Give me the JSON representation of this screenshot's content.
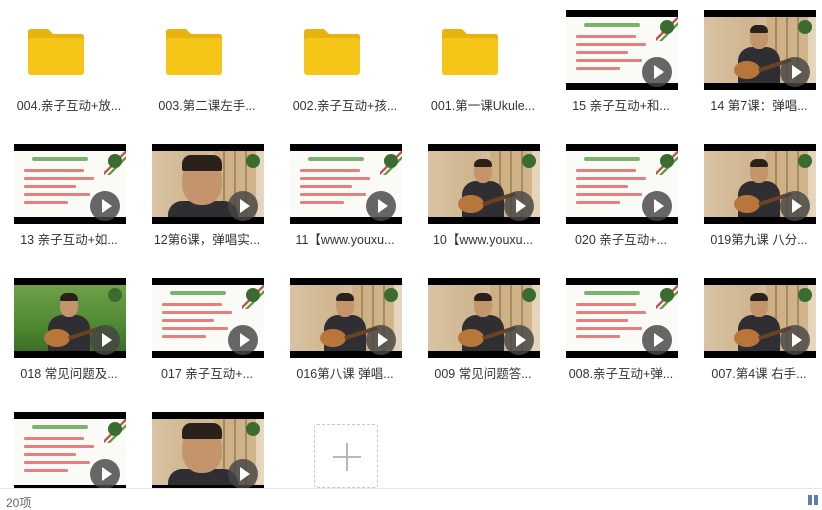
{
  "items": [
    {
      "type": "folder",
      "label": "004.亲子互动+放..."
    },
    {
      "type": "folder",
      "label": "003.第二课左手..."
    },
    {
      "type": "folder",
      "label": "002.亲子互动+孩..."
    },
    {
      "type": "folder",
      "label": "001.第一课Ukule..."
    },
    {
      "type": "video",
      "thumb": "slide",
      "label": "15  亲子互动+和..."
    },
    {
      "type": "video",
      "thumb": "person",
      "label": "14  第7课：弹唱..."
    },
    {
      "type": "video",
      "thumb": "slide",
      "label": "13  亲子互动+如..."
    },
    {
      "type": "video",
      "thumb": "close",
      "label": "12第6课，弹唱实..."
    },
    {
      "type": "video",
      "thumb": "slide",
      "label": "11【www.youxu..."
    },
    {
      "type": "video",
      "thumb": "person",
      "label": "10【www.youxu..."
    },
    {
      "type": "video",
      "thumb": "slide",
      "label": "020 亲子互动+..."
    },
    {
      "type": "video",
      "thumb": "person",
      "label": "019第九课 八分..."
    },
    {
      "type": "video",
      "thumb": "outdoor",
      "label": "018 常见问题及..."
    },
    {
      "type": "video",
      "thumb": "slide",
      "label": "017 亲子互动+..."
    },
    {
      "type": "video",
      "thumb": "person",
      "label": "016第八课 弹唱..."
    },
    {
      "type": "video",
      "thumb": "person",
      "label": "009 常见问题答..."
    },
    {
      "type": "video",
      "thumb": "slide",
      "label": "008.亲子互动+弹..."
    },
    {
      "type": "video",
      "thumb": "person",
      "label": "007.第4课 右手..."
    },
    {
      "type": "video",
      "thumb": "slide",
      "label": ""
    },
    {
      "type": "video",
      "thumb": "close",
      "label": ""
    }
  ],
  "add_button": {
    "icon": "plus-icon"
  },
  "status": {
    "count": "20项"
  },
  "colors": {
    "folder": "#f5c518",
    "folder_tab": "#e8b20f",
    "accent": "#5a7fb0"
  }
}
